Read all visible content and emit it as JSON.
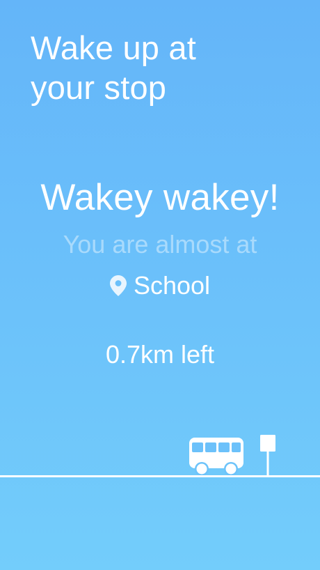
{
  "headline": {
    "line1": "Wake up at",
    "line2": "your stop"
  },
  "alarm": {
    "greeting": "Wakey wakey!",
    "subtitle": "You are almost at",
    "stop_icon": "map-pin-icon",
    "stop_name": "School",
    "distance": "0.7km left"
  },
  "scene": {
    "vehicle_icon": "bus-icon",
    "stop_sign_icon": "bus-stop-sign-icon"
  },
  "colors": {
    "background_top": "#64b5f9",
    "background_bottom": "#73cdfb",
    "foreground": "#ffffff"
  }
}
